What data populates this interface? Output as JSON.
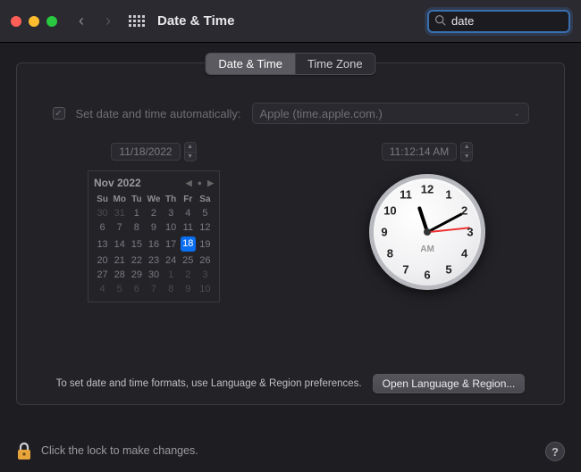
{
  "window": {
    "title": "Date & Time"
  },
  "search": {
    "value": "date"
  },
  "tabs": {
    "date_time": "Date & Time",
    "time_zone": "Time Zone"
  },
  "auto": {
    "label": "Set date and time automatically:",
    "server": "Apple (time.apple.com.)"
  },
  "date_field": "11/18/2022",
  "time_field": "11:12:14 AM",
  "calendar": {
    "month_label": "Nov 2022",
    "dow": [
      "Su",
      "Mo",
      "Tu",
      "We",
      "Th",
      "Fr",
      "Sa"
    ],
    "weeks": [
      [
        {
          "d": 30,
          "dim": true
        },
        {
          "d": 31,
          "dim": true
        },
        {
          "d": 1
        },
        {
          "d": 2
        },
        {
          "d": 3
        },
        {
          "d": 4
        },
        {
          "d": 5
        }
      ],
      [
        {
          "d": 6
        },
        {
          "d": 7
        },
        {
          "d": 8
        },
        {
          "d": 9
        },
        {
          "d": 10
        },
        {
          "d": 11
        },
        {
          "d": 12
        }
      ],
      [
        {
          "d": 13
        },
        {
          "d": 14
        },
        {
          "d": 15
        },
        {
          "d": 16
        },
        {
          "d": 17
        },
        {
          "d": 18,
          "sel": true
        },
        {
          "d": 19
        }
      ],
      [
        {
          "d": 20
        },
        {
          "d": 21
        },
        {
          "d": 22
        },
        {
          "d": 23
        },
        {
          "d": 24
        },
        {
          "d": 25
        },
        {
          "d": 26
        }
      ],
      [
        {
          "d": 27
        },
        {
          "d": 28
        },
        {
          "d": 29
        },
        {
          "d": 30
        },
        {
          "d": 1,
          "dim": true
        },
        {
          "d": 2,
          "dim": true
        },
        {
          "d": 3,
          "dim": true
        }
      ],
      [
        {
          "d": 4,
          "dim": true
        },
        {
          "d": 5,
          "dim": true
        },
        {
          "d": 6,
          "dim": true
        },
        {
          "d": 7,
          "dim": true
        },
        {
          "d": 8,
          "dim": true
        },
        {
          "d": 9,
          "dim": true
        },
        {
          "d": 10,
          "dim": true
        }
      ]
    ]
  },
  "clock": {
    "ampm": "AM",
    "numbers": [
      "12",
      "1",
      "2",
      "3",
      "4",
      "5",
      "6",
      "7",
      "8",
      "9",
      "10",
      "11"
    ]
  },
  "footer": {
    "hint": "To set date and time formats, use Language & Region preferences.",
    "open_button": "Open Language & Region..."
  },
  "lock_hint": "Click the lock to make changes.",
  "help": "?"
}
